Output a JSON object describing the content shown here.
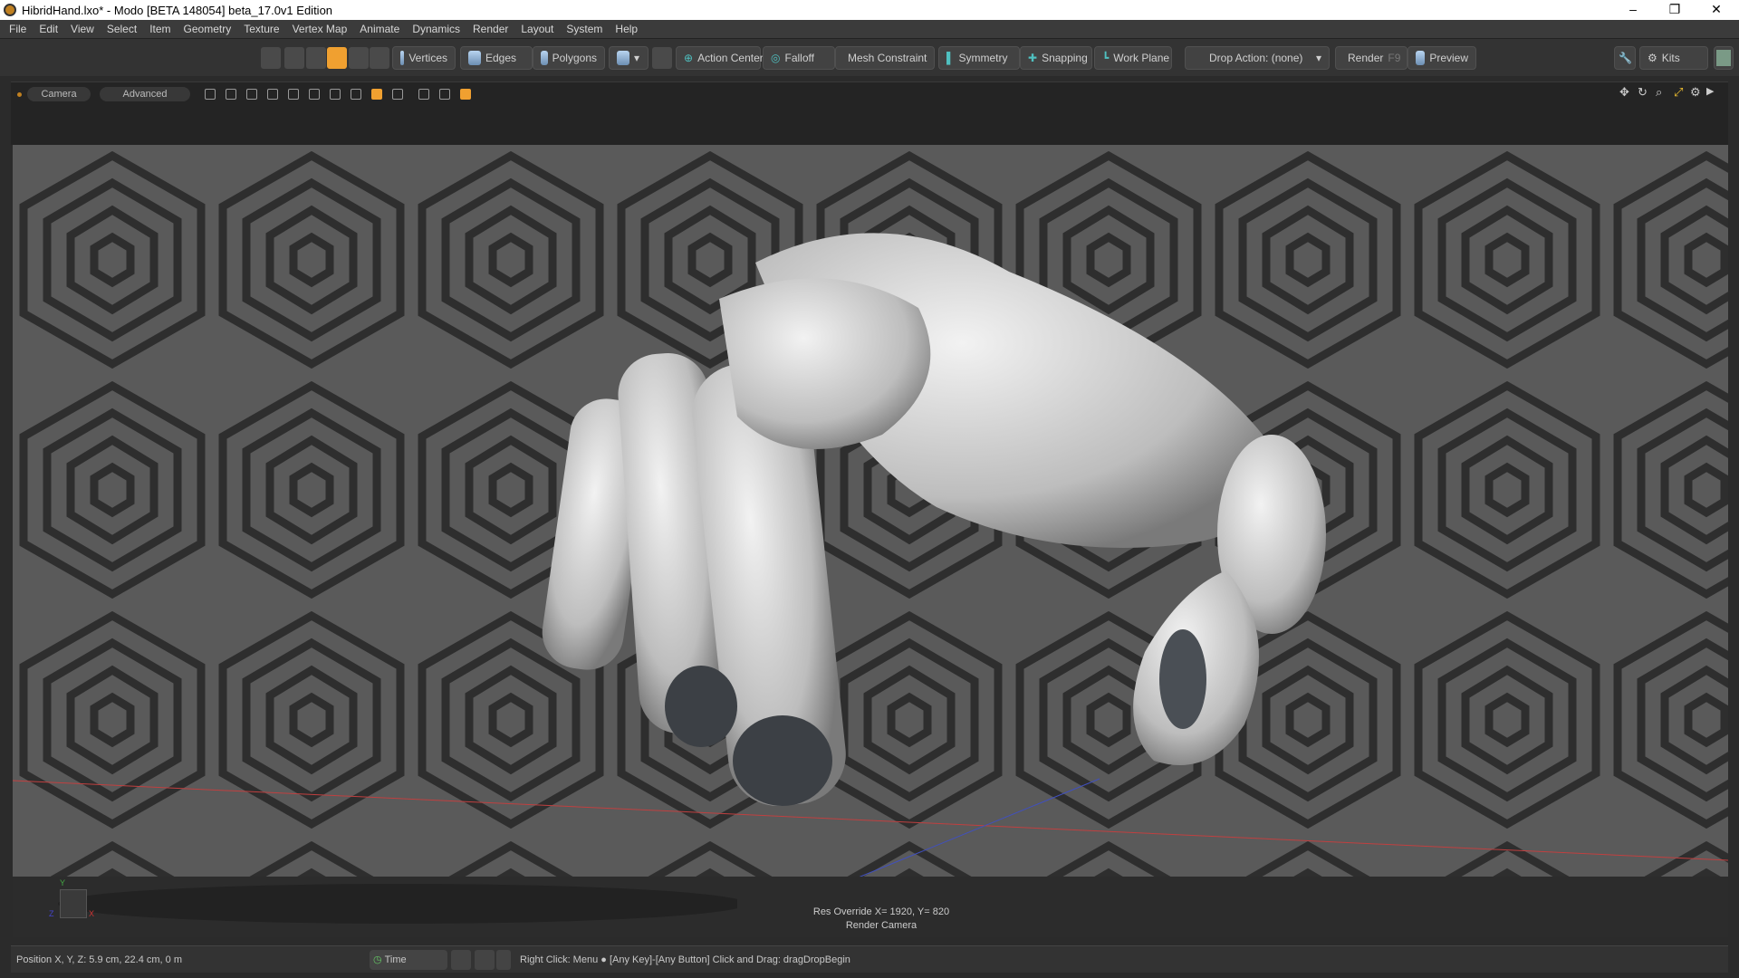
{
  "window": {
    "title": "HibridHand.lxo* - Modo [BETA 148054]  beta_17.0v1 Edition",
    "minimize": "–",
    "restore": "❐",
    "close": "✕"
  },
  "menu": [
    "File",
    "Edit",
    "View",
    "Select",
    "Item",
    "Geometry",
    "Texture",
    "Vertex Map",
    "Animate",
    "Dynamics",
    "Render",
    "Layout",
    "System",
    "Help"
  ],
  "toolbar": {
    "vertices": "Vertices",
    "edges": "Edges",
    "polygons": "Polygons",
    "action_center": "Action Center",
    "falloff": "Falloff",
    "mesh_constraint": "Mesh Constraint",
    "symmetry": "Symmetry",
    "snapping": "Snapping",
    "work_plane": "Work Plane",
    "drop_action": "Drop Action: (none)",
    "render": "Render",
    "render_key": "F9",
    "preview": "Preview",
    "kits": "Kits"
  },
  "viewport": {
    "camera_tab": "Camera",
    "advanced_tab": "Advanced",
    "res_override": "Res Override  X= 1920, Y= 820",
    "render_camera": "Render Camera",
    "axes": {
      "y": "Y",
      "x": "X",
      "z": "Z"
    }
  },
  "status": {
    "position": "Position X, Y, Z:   5.9 cm, 22.4 cm, 0 m",
    "time": "Time",
    "hint": "Right Click: Menu ● [Any Key]-[Any Button] Click and Drag: dragDropBegin"
  },
  "colors": {
    "accent": "#f0a030",
    "selection": "#f4a63a"
  }
}
